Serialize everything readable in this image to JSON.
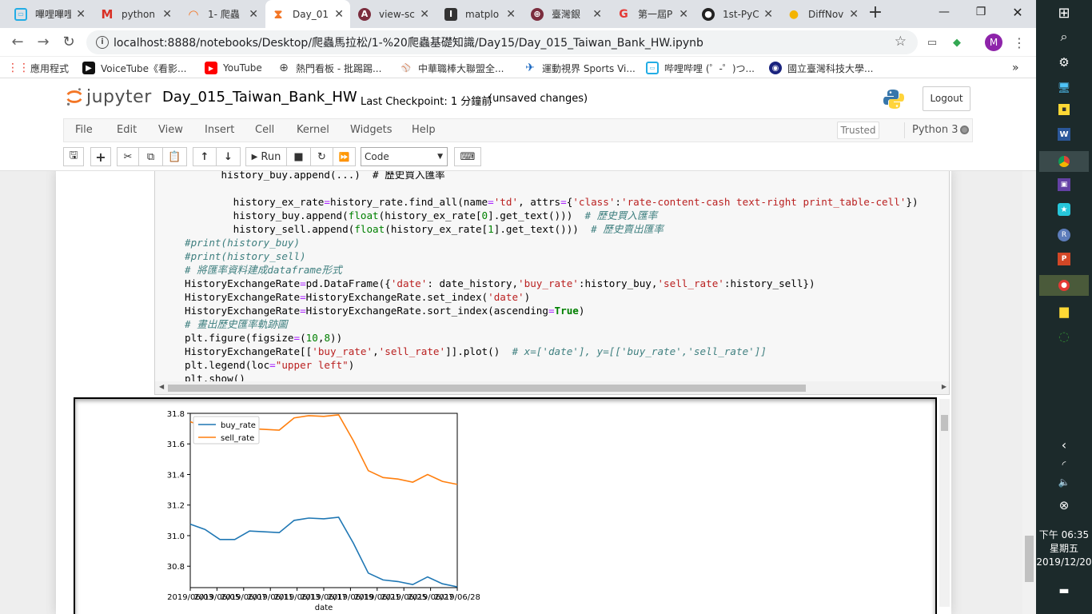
{
  "tabs": [
    "嗶哩嗶哩",
    "python",
    "1- 爬蟲",
    "Day_01",
    "view-sc",
    "matplo",
    "臺灣銀",
    "第一屆P",
    "1st-PyC",
    "DiffNov"
  ],
  "browser": {
    "url": "localhost:8888/notebooks/Desktop/爬蟲馬拉松/1-%20爬蟲基礎知識/Day15/Day_015_Taiwan_Bank_HW.ipynb",
    "avatar": "M"
  },
  "bookmarks": [
    "應用程式",
    "VoiceTube《看影...",
    "YouTube",
    "熱門看板 - 批踢踢...",
    "中華職棒大聯盟全...",
    "運動視界 Sports Vi...",
    "哔哩哔哩 (゜-゜)つ...",
    "國立臺灣科技大學..."
  ],
  "jupyter": {
    "logo_text": "jupyter",
    "notebook_name": "Day_015_Taiwan_Bank_HW",
    "checkpoint": "Last Checkpoint: 1 分鐘前",
    "unsaved": "(unsaved changes)",
    "logout": "Logout",
    "trusted": "Trusted",
    "kernel": "Python 3"
  },
  "menu": [
    "File",
    "Edit",
    "View",
    "Insert",
    "Cell",
    "Kernel",
    "Widgets",
    "Help"
  ],
  "toolbar": {
    "run_label": "Run",
    "cell_type": "Code"
  },
  "code": {
    "line0": "history_buy.append(...)  # 歷史買入匯率"
  },
  "taskbar": {
    "time": "下午 06:35",
    "weekday": "星期五",
    "date": "2019/12/20"
  },
  "colors": {
    "buy_rate": "#1f77b4",
    "sell_rate": "#ff7f0e",
    "accent": "#f37626"
  },
  "chart_data": {
    "type": "line",
    "xlabel": "date",
    "ylabel": "",
    "x": [
      "2019/06/03",
      "2019/06/04",
      "2019/06/05",
      "2019/06/06",
      "2019/06/10",
      "2019/06/11",
      "2019/06/12",
      "2019/06/13",
      "2019/06/14",
      "2019/06/17",
      "2019/06/18",
      "2019/06/19",
      "2019/06/20",
      "2019/06/21",
      "2019/06/24",
      "2019/06/25",
      "2019/06/26",
      "2019/06/27",
      "2019/06/28"
    ],
    "xtick_labels": [
      "2019/06/03",
      "2019/06/05",
      "2019/06/07",
      "2019/06/11",
      "2019/06/13",
      "2019/06/17",
      "2019/06/19",
      "2019/06/21",
      "2019/06/25",
      "2019/06/27",
      "2019/06/28"
    ],
    "series": [
      {
        "name": "buy_rate",
        "values": [
          31.075,
          31.04,
          30.975,
          30.975,
          31.03,
          31.025,
          31.02,
          31.1,
          31.115,
          31.11,
          31.12,
          30.95,
          30.755,
          30.71,
          30.7,
          30.68,
          30.73,
          30.685,
          30.665
        ]
      },
      {
        "name": "sell_rate",
        "values": [
          31.745,
          31.71,
          31.645,
          31.645,
          31.7,
          31.695,
          31.69,
          31.77,
          31.785,
          31.78,
          31.79,
          31.62,
          31.425,
          31.38,
          31.37,
          31.35,
          31.4,
          31.355,
          31.335
        ]
      }
    ],
    "ylim": [
      30.66,
      31.8
    ],
    "yticks": [
      "30.8",
      "31.0",
      "31.2",
      "31.4",
      "31.6",
      "31.8"
    ],
    "grid": false,
    "legend": "upper left"
  }
}
